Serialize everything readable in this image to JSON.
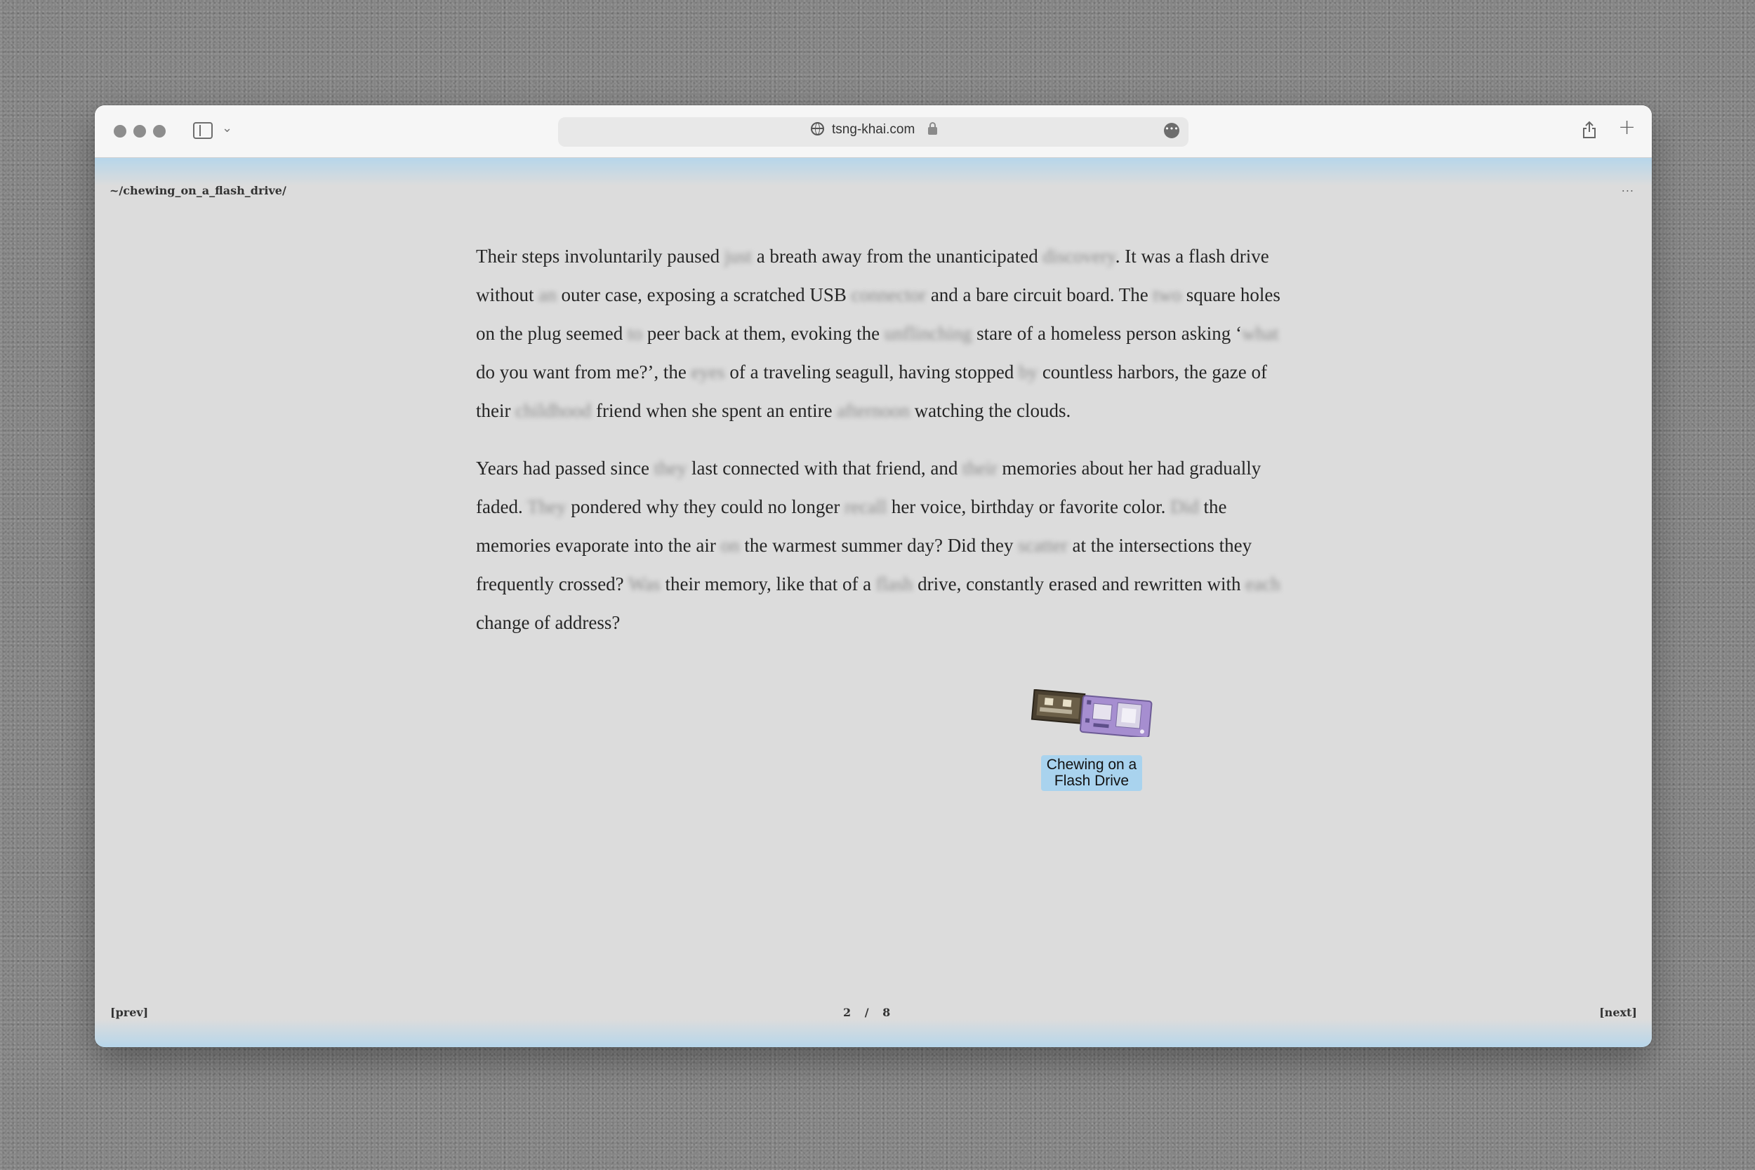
{
  "browser": {
    "url": "tsng-khai.com"
  },
  "page": {
    "path": "~/chewing_on_a_flash_drive/",
    "menu": "...",
    "paragraphs": [
      [
        {
          "t": "Their steps involuntarily paused "
        },
        {
          "t": "just",
          "blur": true
        },
        {
          "t": " a breath away from the unanticipated "
        },
        {
          "t": "discovery",
          "blur": true
        },
        {
          "t": ". It was a flash drive without "
        },
        {
          "t": "an",
          "blur": true
        },
        {
          "t": " outer case, exposing a scratched USB "
        },
        {
          "t": "connector",
          "blur": true
        },
        {
          "t": " and a bare circuit board. The "
        },
        {
          "t": "two",
          "blur": true
        },
        {
          "t": " square holes on the plug seemed "
        },
        {
          "t": "to",
          "blur": true
        },
        {
          "t": " peer back at them, evoking the "
        },
        {
          "t": "unflinching",
          "blur": true
        },
        {
          "t": " stare of a homeless person asking ‘"
        },
        {
          "t": "what",
          "blur": true
        },
        {
          "t": " do you want from me?’, the "
        },
        {
          "t": "eyes",
          "blur": true
        },
        {
          "t": " of a traveling seagull, having stopped "
        },
        {
          "t": "by",
          "blur": true
        },
        {
          "t": " countless harbors, the gaze of their "
        },
        {
          "t": "childhood",
          "blur": true
        },
        {
          "t": " friend when she spent an entire "
        },
        {
          "t": "afternoon",
          "blur": true
        },
        {
          "t": " watching the clouds."
        }
      ],
      [
        {
          "t": "Years had passed since "
        },
        {
          "t": "they",
          "blur": true
        },
        {
          "t": " last connected with that friend, and "
        },
        {
          "t": "their",
          "blur": true
        },
        {
          "t": " memories about her had gradually faded. "
        },
        {
          "t": "They",
          "blur": true
        },
        {
          "t": " pondered why they could no longer "
        },
        {
          "t": "recall",
          "blur": true
        },
        {
          "t": " her voice, birthday or favorite color. "
        },
        {
          "t": "Did",
          "blur": true
        },
        {
          "t": " the memories evaporate into the air "
        },
        {
          "t": "on",
          "blur": true
        },
        {
          "t": " the warmest summer day? Did they "
        },
        {
          "t": "scatter",
          "blur": true
        },
        {
          "t": " at the intersections they frequently crossed? "
        },
        {
          "t": "Was",
          "blur": true
        },
        {
          "t": " their memory, like that of a "
        },
        {
          "t": "flash",
          "blur": true
        },
        {
          "t": " drive, constantly erased and rewritten with "
        },
        {
          "t": "each",
          "blur": true
        },
        {
          "t": " change of address?"
        }
      ]
    ],
    "caption": "Chewing on a Flash Drive",
    "prev_label": "[prev]",
    "next_label": "[next]",
    "pager": "2 / 8"
  },
  "colors": {
    "window_bg": "#dcdcdc",
    "band_blue": "#b7d6ea",
    "caption_bg": "#a9d3ee",
    "pcb_purple": "#a68ed0"
  }
}
